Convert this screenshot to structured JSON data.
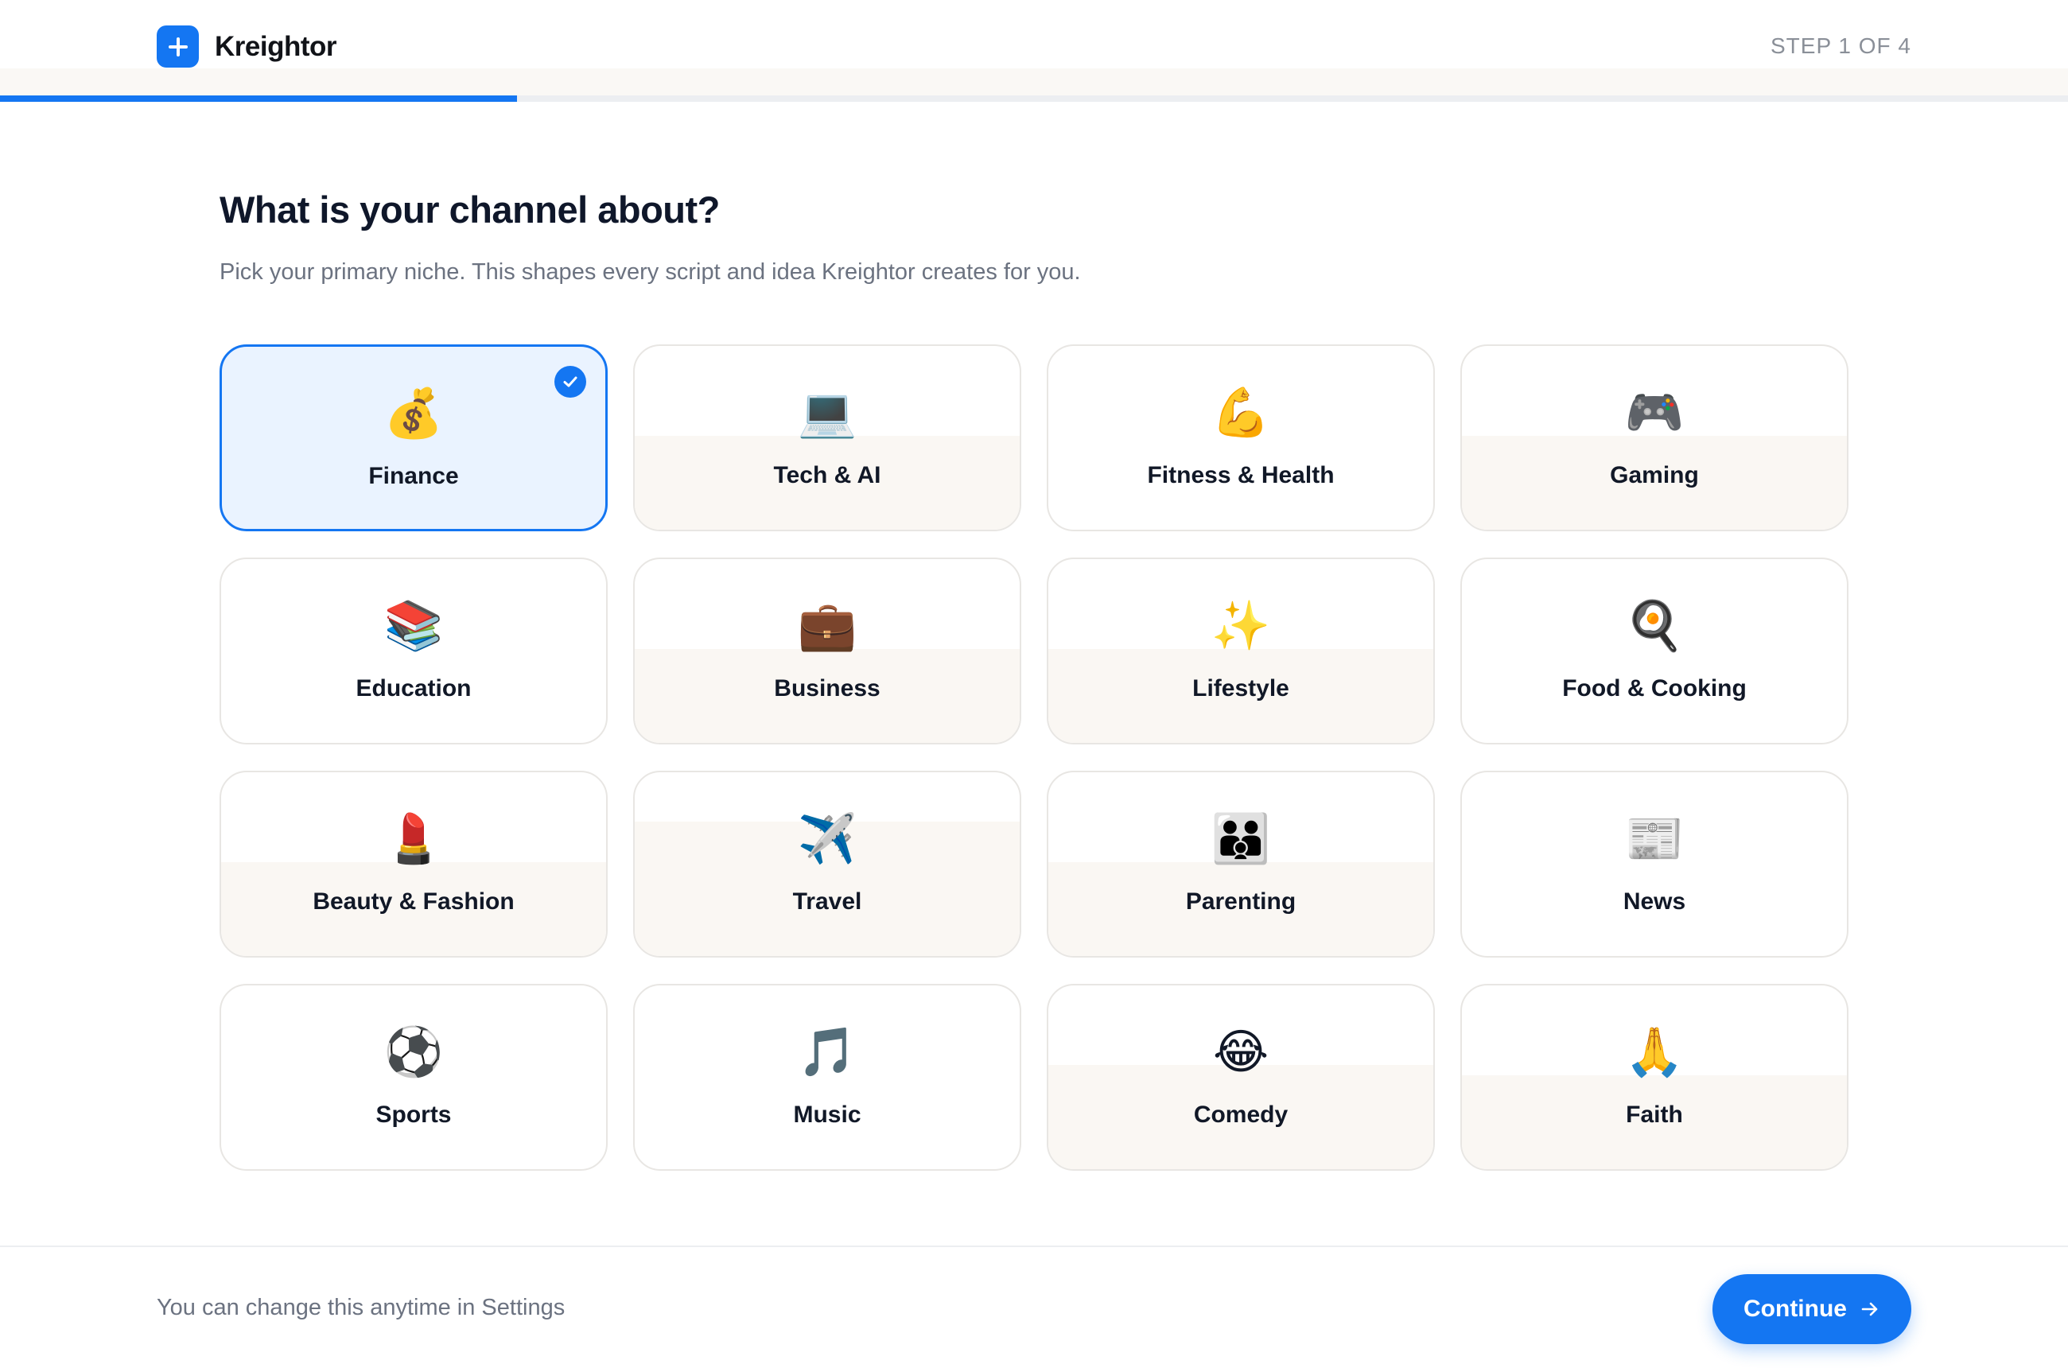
{
  "app": {
    "name": "Kreightor"
  },
  "header": {
    "step_text": "STEP 1 OF 4",
    "progress_fraction": 0.25
  },
  "main": {
    "title": "What is your channel about?",
    "subtitle": "Pick your primary niche. This shapes every script and idea Kreightor creates for you."
  },
  "niches": [
    {
      "label": "Finance",
      "emoji": "💰",
      "selected": true
    },
    {
      "label": "Tech & AI",
      "emoji": "💻",
      "selected": false
    },
    {
      "label": "Fitness & Health",
      "emoji": "💪",
      "selected": false
    },
    {
      "label": "Gaming",
      "emoji": "🎮",
      "selected": false
    },
    {
      "label": "Education",
      "emoji": "📚",
      "selected": false
    },
    {
      "label": "Business",
      "emoji": "💼",
      "selected": false
    },
    {
      "label": "Lifestyle",
      "emoji": "✨",
      "selected": false
    },
    {
      "label": "Food & Cooking",
      "emoji": "🍳",
      "selected": false
    },
    {
      "label": "Beauty & Fashion",
      "emoji": "💄",
      "selected": false
    },
    {
      "label": "Travel",
      "emoji": "✈️",
      "selected": false
    },
    {
      "label": "Parenting",
      "emoji": "👪",
      "selected": false
    },
    {
      "label": "News",
      "emoji": "📰",
      "selected": false
    },
    {
      "label": "Sports",
      "emoji": "⚽",
      "selected": false
    },
    {
      "label": "Music",
      "emoji": "🎵",
      "selected": false
    },
    {
      "label": "Comedy",
      "emoji": "😂",
      "selected": false
    },
    {
      "label": "Faith",
      "emoji": "🙏",
      "selected": false
    }
  ],
  "footer": {
    "note": "You can change this anytime in Settings",
    "continue_label": "Continue"
  },
  "colors": {
    "accent": "#1476f2",
    "selected_bg": "#eaf3ff"
  }
}
